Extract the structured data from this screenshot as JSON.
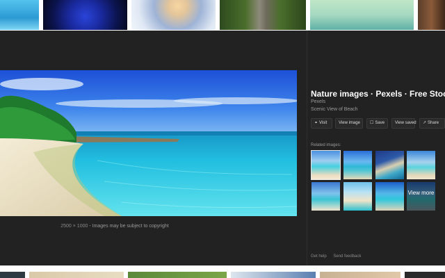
{
  "top_thumbnails": [
    {
      "name": "sea-thumbnail"
    },
    {
      "name": "blue-rose-thumbnail"
    },
    {
      "name": "snow-sunset-thumbnail"
    },
    {
      "name": "railway-thumbnail"
    },
    {
      "name": "kingfisher-birds-thumbnail"
    },
    {
      "name": "wood-thumbnail"
    }
  ],
  "preview": {
    "title": "Nature images · Pexels · Free Stock Photos",
    "source": "Pexels",
    "description": "Scenic View of Beach",
    "dimensions": "2500 × 1000",
    "copyright": "Images may be subject to copyright",
    "buttons": {
      "visit": "Visit",
      "view_image": "View image",
      "save": "Save",
      "view_saved": "View saved",
      "share": "Share"
    },
    "related_label": "Related images:",
    "view_more": "View more"
  },
  "footer": {
    "help": "Get help",
    "feedback": "Send feedback"
  },
  "colors": {
    "panel_bg": "#222222",
    "title_text": "#ffffff",
    "muted_text": "#9a9a9a"
  }
}
